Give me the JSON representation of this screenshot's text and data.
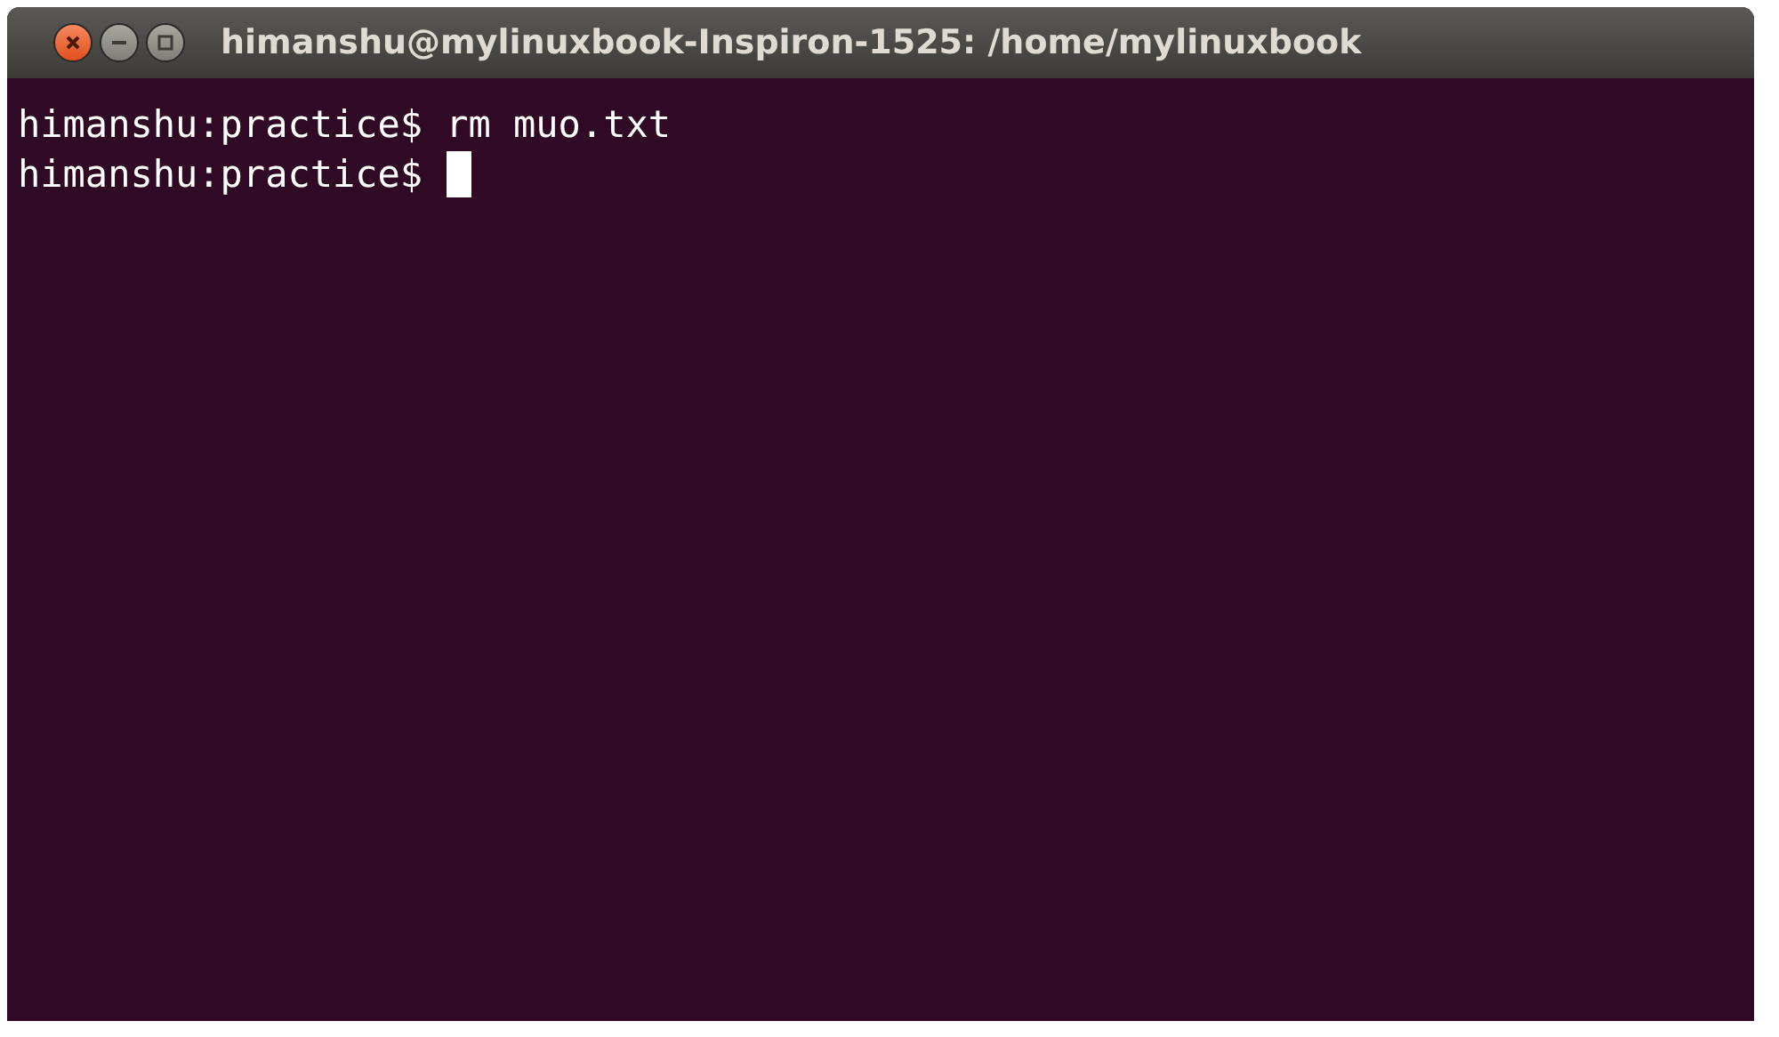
{
  "window": {
    "title": "himanshu@mylinuxbook-Inspiron-1525: /home/mylinuxbook"
  },
  "terminal": {
    "lines": [
      {
        "prompt": "himanshu:practice$",
        "command": "rm muo.txt",
        "cursor": false
      },
      {
        "prompt": "himanshu:practice$",
        "cursor": true
      }
    ]
  }
}
